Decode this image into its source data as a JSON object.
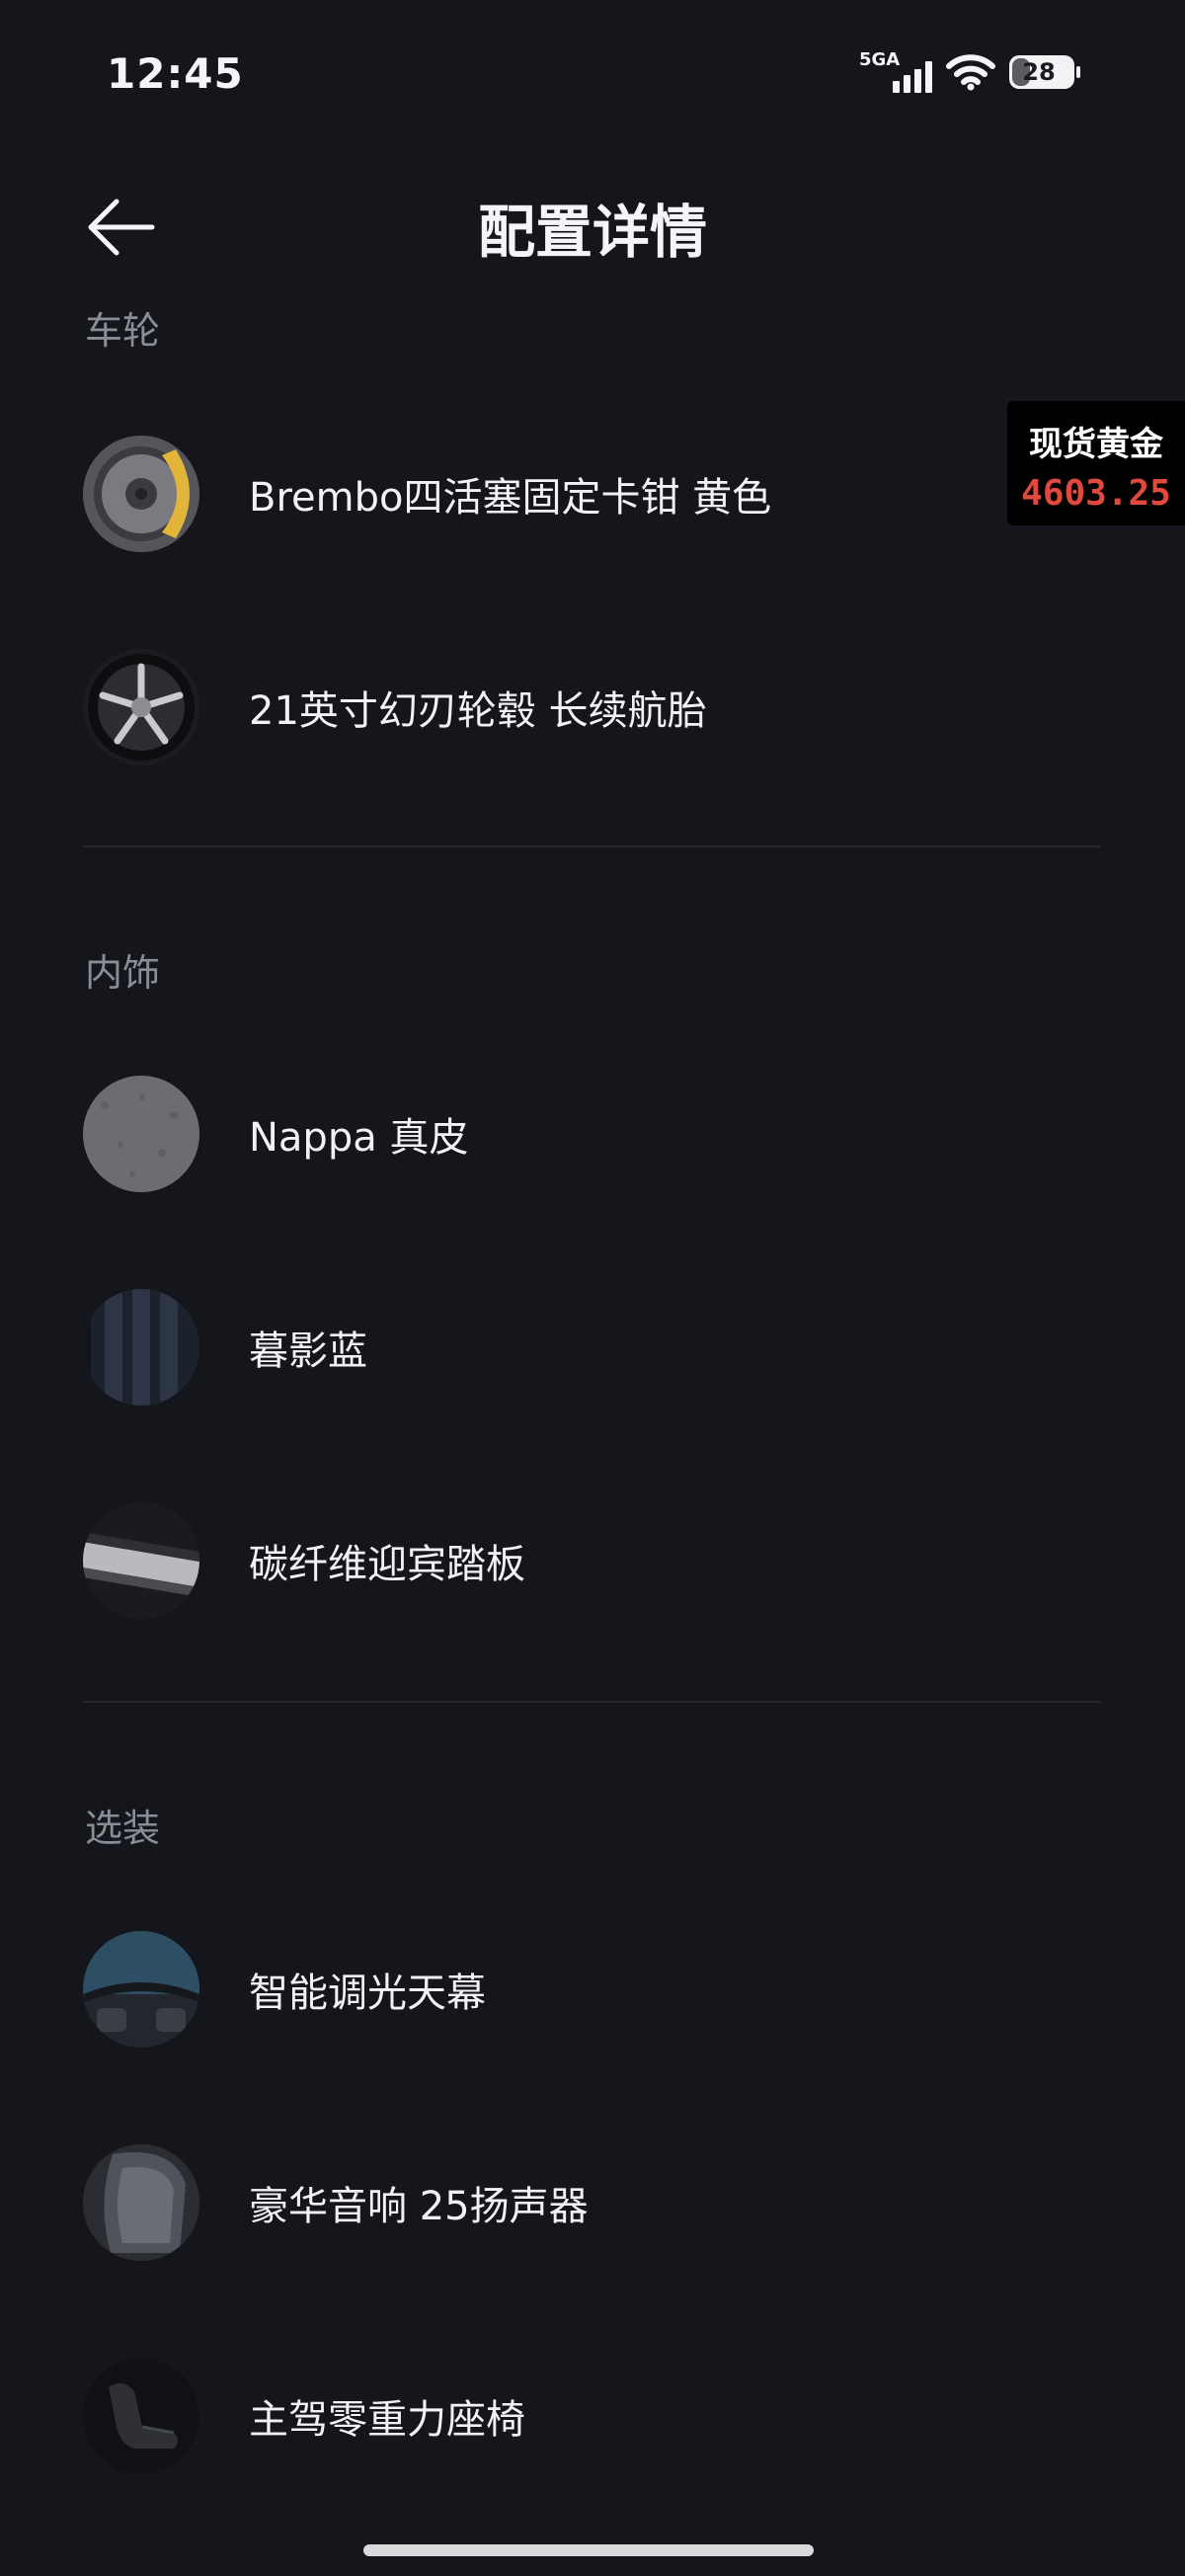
{
  "status_bar": {
    "time": "12:45",
    "network_label": "5GA",
    "battery_level": "28"
  },
  "header": {
    "title": "配置详情"
  },
  "sections": [
    {
      "title": "车轮",
      "items": [
        {
          "label": "Brembo四活塞固定卡钳 黄色",
          "icon": "brake-caliper-icon"
        },
        {
          "label": "21英寸幻刃轮毂 长续航胎",
          "icon": "wheel-icon"
        }
      ]
    },
    {
      "title": "内饰",
      "items": [
        {
          "label": "Nappa 真皮",
          "icon": "leather-swatch-icon"
        },
        {
          "label": "暮影蓝",
          "icon": "interior-color-swatch-icon"
        },
        {
          "label": "碳纤维迎宾踏板",
          "icon": "door-sill-plate-icon"
        }
      ]
    },
    {
      "title": "选装",
      "items": [
        {
          "label": "智能调光天幕",
          "icon": "sunroof-icon"
        },
        {
          "label": "豪华音响 25扬声器",
          "icon": "speaker-icon"
        },
        {
          "label": "主驾零重力座椅",
          "icon": "seat-icon"
        }
      ]
    }
  ],
  "gold_widget": {
    "name": "现货黄金",
    "price": "4603.25"
  },
  "colors": {
    "background": "#15161b",
    "section_title": "#8b8d96",
    "price_red": "#e0493e",
    "caliper_yellow": "#e2b43a"
  }
}
